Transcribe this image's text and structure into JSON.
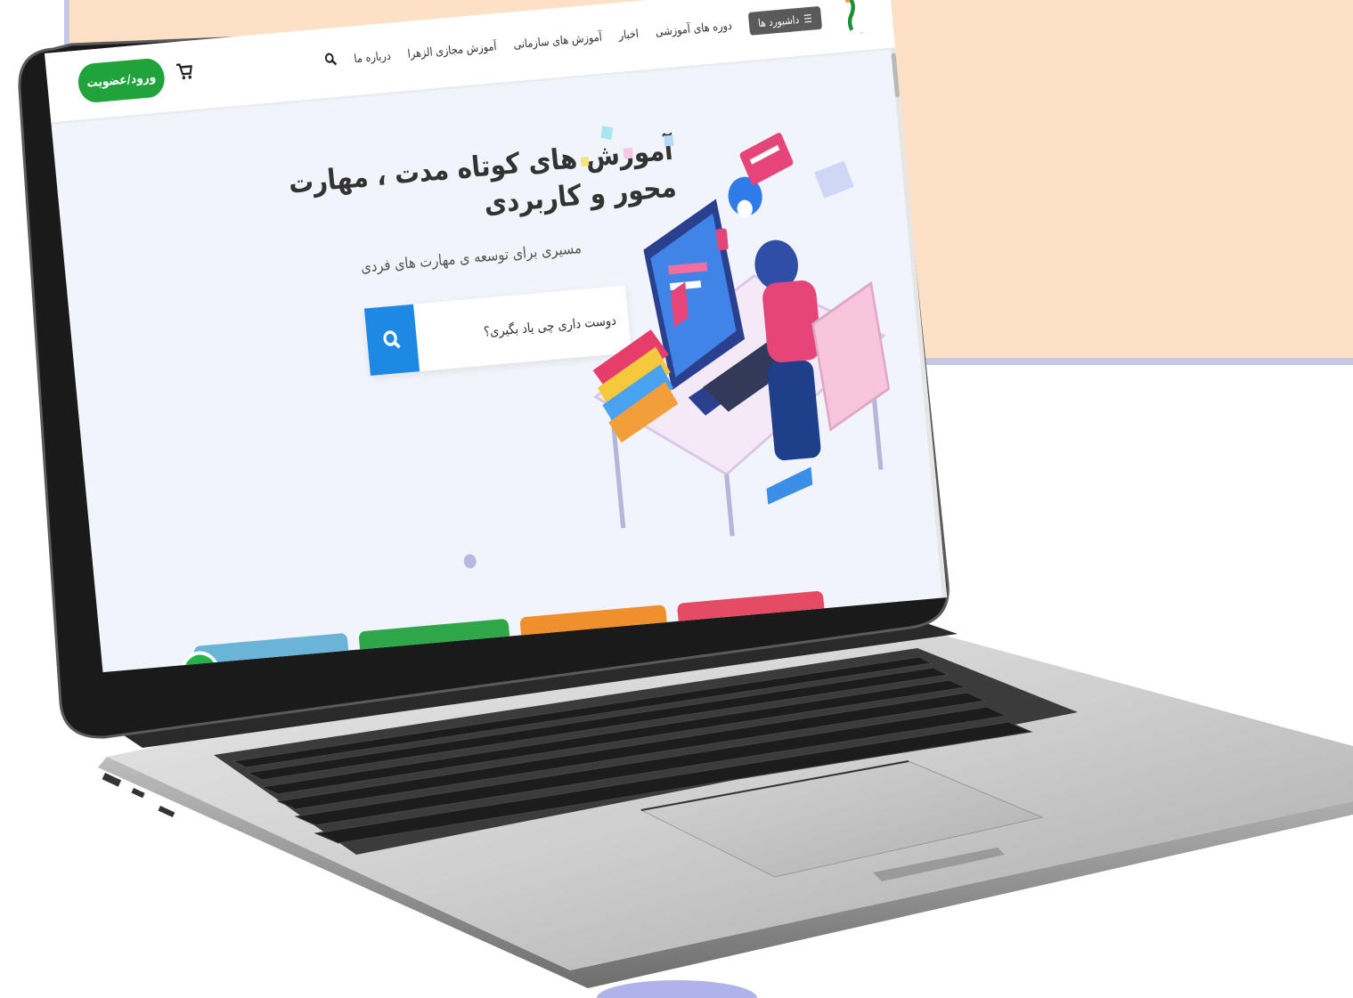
{
  "nav": {
    "dashboard_label": "داشبورد ها",
    "items": [
      "دوره های آموزشی",
      "اخبار",
      "آموزش های سازمانی",
      "آموزش مجازی الزهرا",
      "درباره ما"
    ],
    "login_label": "ورود/عضویت"
  },
  "hero": {
    "title": "آموزش های کوتاه مدت ، مهارت محور و کاربردی",
    "subtitle": "مسیری برای توسعه ی مهارت های فردی"
  },
  "search": {
    "placeholder": "دوست داری چی یاد بگیری؟"
  },
  "icons": {
    "search": "search-icon",
    "cart": "cart-icon",
    "menu": "hamburger-icon",
    "chat": "chat-icon",
    "logo": "alzahra-logo"
  },
  "colors": {
    "login_green": "#21a33c",
    "search_blue": "#1e88e5",
    "background_panel": "#fde0c6",
    "hero_background": "#f2f4fb"
  }
}
